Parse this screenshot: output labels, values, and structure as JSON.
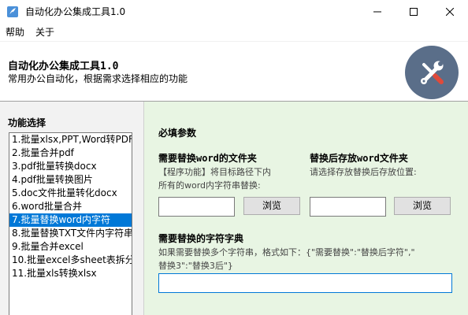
{
  "window": {
    "title": "自动化办公集成工具1.0",
    "controls": {
      "minimize": "minimize",
      "maximize": "maximize",
      "close": "close"
    }
  },
  "menu": [
    "帮助",
    "关于"
  ],
  "header": {
    "title": "自动化办公集成工具1.0",
    "subtitle": "常用办公自动化，根据需求选择相应的功能",
    "logo_icon": "tools-icon",
    "logo_color": "#5a6e89"
  },
  "sidebar": {
    "title": "功能选择",
    "selected_index": 6,
    "items": [
      "1.批量xlsx,PPT,Word转PDF",
      "2.批量合并pdf",
      "3.pdf批量转换docx",
      "4.pdf批量转换图片",
      "5.doc文件批量转化docx",
      "6.word批量合并",
      "7.批量替换word内字符",
      "8.批量替换TXT文件内字符串",
      "9.批量合并excel",
      "10.批量excel多sheet表拆分",
      "11.批量xls转换xlsx"
    ]
  },
  "main": {
    "section_title": "必填参数",
    "source": {
      "title": "需要替换word的文件夹",
      "desc_line1": "【程序功能】将目标路径下内",
      "desc_line2": "所有的word内字符串替换:",
      "value": "",
      "browse_label": "浏览"
    },
    "target": {
      "title": "替换后存放word文件夹",
      "desc": "请选择存放替换后存放位置:",
      "value": "",
      "browse_label": "浏览"
    },
    "dict": {
      "title": "需要替换的字符字典",
      "desc_line1": "如果需要替换多个字符串，格式如下：{\"需要替换\":\"替换后字符\",\"",
      "desc_line2": "替换3\":\"替换3后\"}",
      "value": ""
    }
  },
  "colors": {
    "accent": "#0078d7",
    "right_panel_bg": "#e8f5e3",
    "left_panel_bg": "#f2f2f2"
  }
}
